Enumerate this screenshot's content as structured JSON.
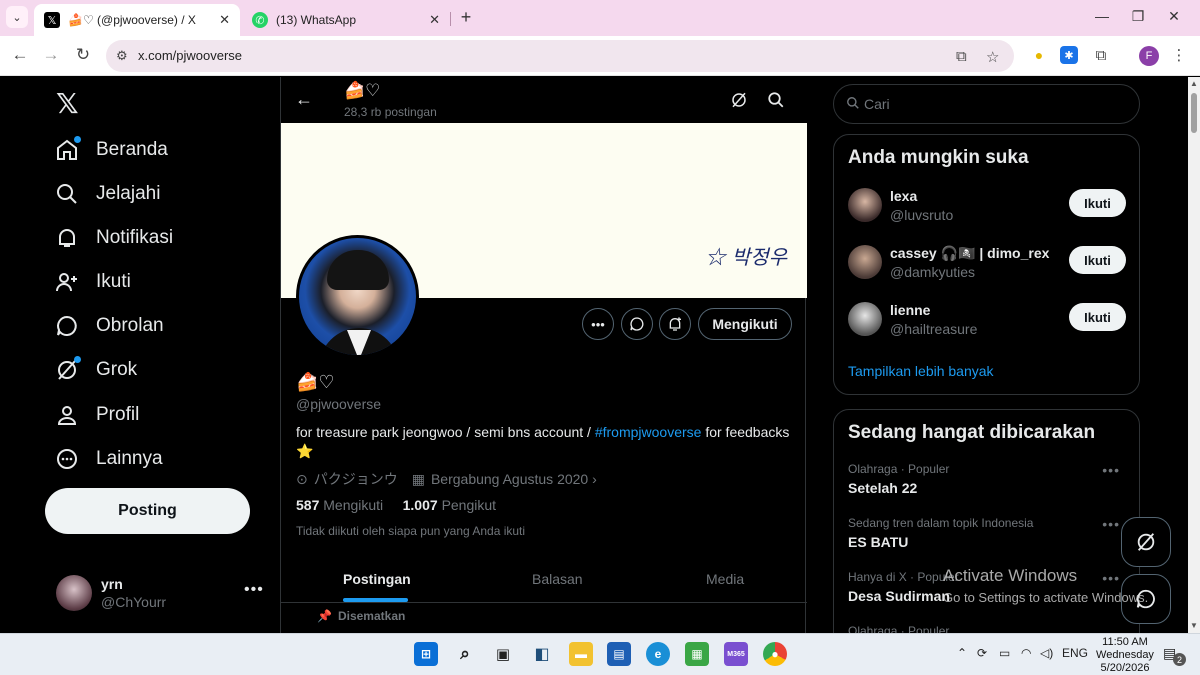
{
  "browser": {
    "tabs": [
      {
        "title": "🍰♡ (@pjwooverse) / X",
        "icon": "x-logo",
        "active": true
      },
      {
        "title": "(13) WhatsApp",
        "icon": "whatsapp-icon",
        "active": false
      }
    ],
    "url": "x.com/pjwooverse",
    "profile_initial": "F"
  },
  "nav": {
    "items": [
      {
        "label": "Beranda",
        "icon": "home-icon"
      },
      {
        "label": "Jelajahi",
        "icon": "search-icon"
      },
      {
        "label": "Notifikasi",
        "icon": "bell-icon"
      },
      {
        "label": "Ikuti",
        "icon": "add-user-icon"
      },
      {
        "label": "Obrolan",
        "icon": "chat-icon"
      },
      {
        "label": "Grok",
        "icon": "grok-icon"
      },
      {
        "label": "Profil",
        "icon": "person-icon"
      },
      {
        "label": "Lainnya",
        "icon": "more-circle-icon"
      }
    ],
    "post_button": "Posting",
    "account": {
      "name": "yrn",
      "handle": "@ChYourr"
    }
  },
  "profile": {
    "header_name": "🍰♡",
    "header_posts": "28,3 rb postingan",
    "banner_signature": "☆ 박정우",
    "name": "🍰♡",
    "handle": "@pjwooverse",
    "bio_prefix": "for treasure park jeongwoo / semi bns account / ",
    "bio_hashtag": "#frompjwooverse",
    "bio_suffix": " for feedbacks",
    "bio_emoji": "⭐",
    "location": "パクジョンウ",
    "joined": "Bergabung Agustus 2020",
    "following_count": "587",
    "following_label": "Mengikuti",
    "followers_count": "1.007",
    "followers_label": "Pengikut",
    "followed_by": "Tidak diikuti oleh siapa pun yang Anda ikuti",
    "follow_button": "Mengikuti",
    "tabs": [
      "Postingan",
      "Balasan",
      "Media"
    ],
    "pinned_label": "Disematkan"
  },
  "sidebar": {
    "search_placeholder": "Cari",
    "suggest_title": "Anda mungkin suka",
    "suggestions": [
      {
        "name": "lexa",
        "handle": "@luvsruto",
        "button": "Ikuti"
      },
      {
        "name": "cassey 🎧🏴‍☠️ | dimo_rex",
        "handle": "@damkyuties",
        "button": "Ikuti"
      },
      {
        "name": "lienne",
        "handle": "@hailtreasure",
        "button": "Ikuti"
      }
    ],
    "show_more": "Tampilkan lebih banyak",
    "trends_title": "Sedang hangat dibicarakan",
    "trends": [
      {
        "context": "Olahraga · Populer",
        "title": "Setelah 22"
      },
      {
        "context": "Sedang tren dalam topik Indonesia",
        "title": "ES BATU"
      },
      {
        "context": "Hanya di X · Populer",
        "title": "Desa Sudirman"
      },
      {
        "context": "Olahraga · Populer",
        "title": ""
      }
    ]
  },
  "watermark": {
    "line1": "Activate Windows",
    "line2": "Go to Settings to activate Windows."
  },
  "taskbar": {
    "lang": "ENG",
    "time": "11:50 AM",
    "day": "Wednesday",
    "date": "5/20/2026",
    "notif_count": "2",
    "m365_label": "M365"
  }
}
